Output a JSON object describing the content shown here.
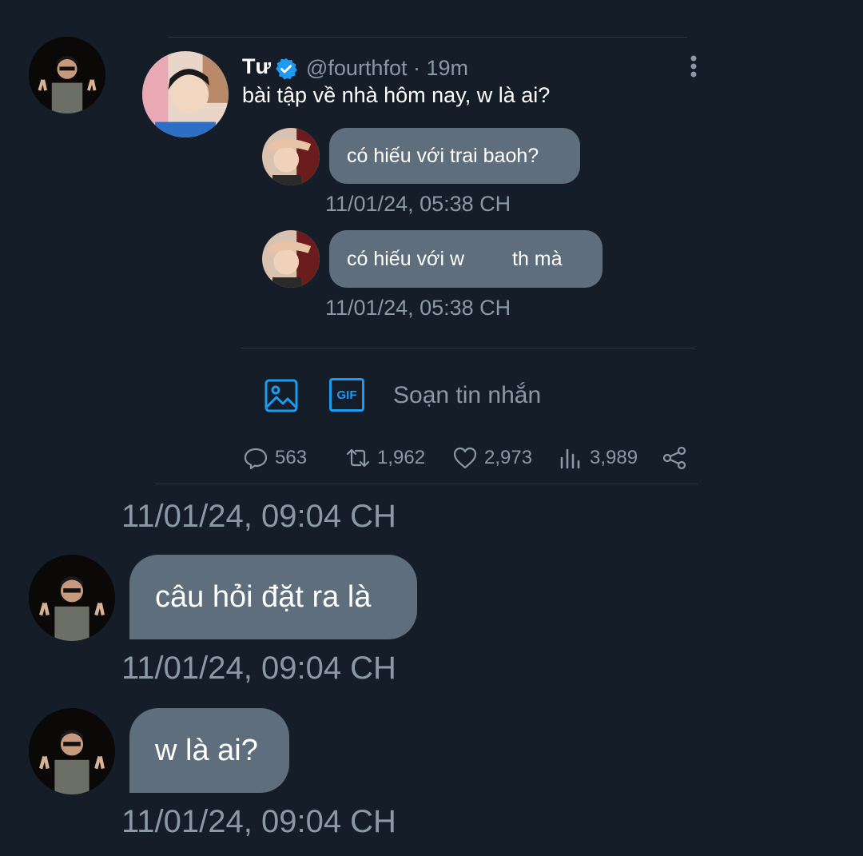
{
  "tweet": {
    "name": "Tư",
    "handle_time": "@fourthfot · 19m",
    "text": "bài tập về nhà hôm nay, w là ai?",
    "icons": {
      "verified": "verified-badge-icon",
      "more": "more-vertical-icon"
    },
    "accent_color": "#1d9bf0"
  },
  "quoted_messages": [
    {
      "text": "có hiếu với trai baoh?",
      "time": "11/01/24, 05:38 CH"
    },
    {
      "text_before": "có hiếu với w",
      "text_after": "th mà",
      "time": "11/01/24, 05:38 CH"
    }
  ],
  "composer": {
    "placeholder": "Soạn tin nhắn",
    "gif_label": "GIF",
    "icons": {
      "image": "image-icon",
      "gif": "gif-icon"
    }
  },
  "actions": {
    "replies": "563",
    "retweets": "1,962",
    "likes": "2,973",
    "views": "3,989",
    "icons": [
      "reply-icon",
      "retweet-icon",
      "heart-icon",
      "views-icon",
      "share-icon"
    ]
  },
  "messages": [
    {
      "time": "11/01/24, 09:04 CH"
    },
    {
      "text": "câu hỏi đặt ra là",
      "time": "11/01/24, 09:04 CH"
    },
    {
      "text": "w là ai?",
      "time": "11/01/24, 09:04 CH"
    }
  ],
  "colors": {
    "background": "#151d28",
    "bubble": "#5f6e7d",
    "muted_text": "#8b98a5",
    "accent": "#1d9bf0"
  }
}
